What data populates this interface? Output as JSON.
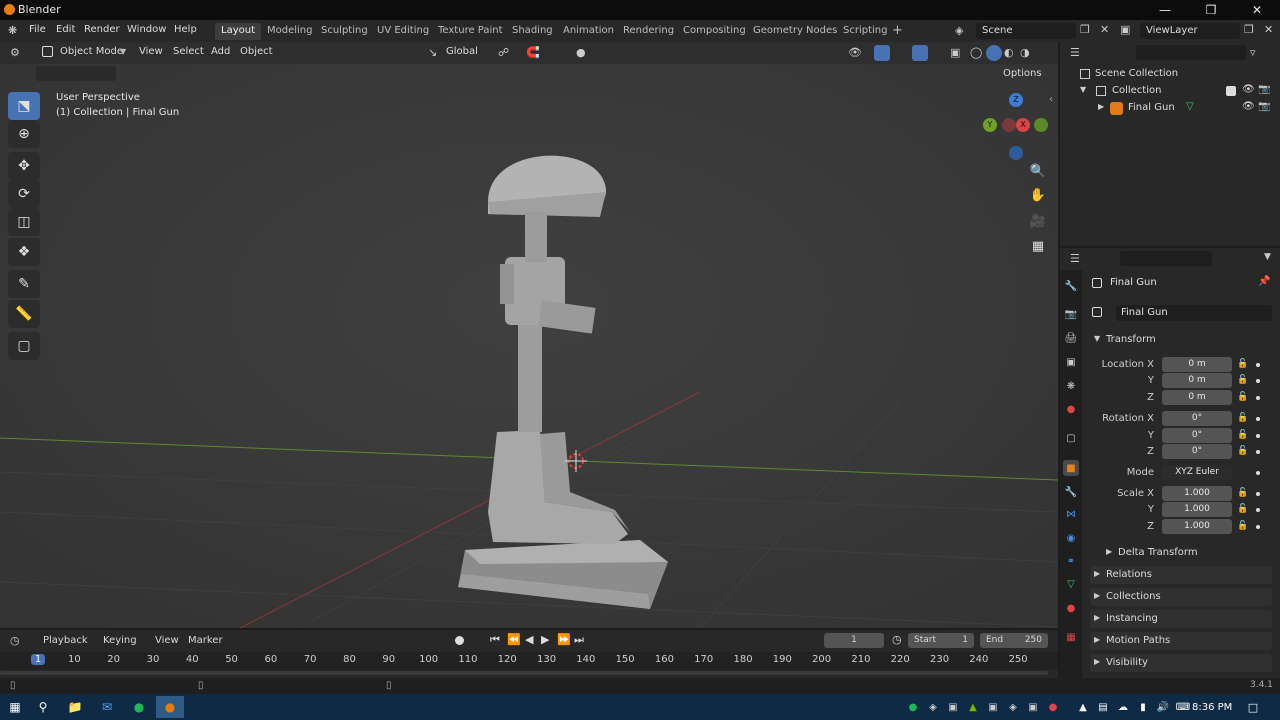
{
  "window": {
    "title": "Blender"
  },
  "menu": [
    "File",
    "Edit",
    "Render",
    "Window",
    "Help"
  ],
  "workspaces": [
    "Layout",
    "Modeling",
    "Sculpting",
    "UV Editing",
    "Texture Paint",
    "Shading",
    "Animation",
    "Rendering",
    "Compositing",
    "Geometry Nodes",
    "Scripting"
  ],
  "active_workspace": "Layout",
  "scene": {
    "scene_name": "Scene",
    "view_layer": "ViewLayer"
  },
  "viewport": {
    "mode": "Object Mode",
    "menus": [
      "View",
      "Select",
      "Add",
      "Object"
    ],
    "transform_orientation": "Global",
    "options_label": "Options",
    "overlay_title": "User Perspective",
    "overlay_subtitle": "(1) Collection | Final Gun",
    "gizmo_labels": {
      "z": "Z",
      "y": "Y",
      "x": "X"
    }
  },
  "outliner": {
    "items": [
      {
        "label": "Scene Collection",
        "icon": "collection-icon"
      },
      {
        "label": "Collection",
        "icon": "collection-icon"
      },
      {
        "label": "Final Gun",
        "icon": "mesh-object-icon"
      }
    ]
  },
  "properties": {
    "object_name": "Final Gun",
    "data_name": "Final Gun",
    "transform_header": "Transform",
    "location_label": "Location X",
    "rotation_label": "Rotation X",
    "scale_label": "Scale X",
    "axis_labels": [
      "Y",
      "Z"
    ],
    "location": [
      "0 m",
      "0 m",
      "0 m"
    ],
    "rotation": [
      "0°",
      "0°",
      "0°"
    ],
    "mode_label": "Mode",
    "mode_value": "XYZ Euler",
    "scale": [
      "1.000",
      "1.000",
      "1.000"
    ],
    "delta_transform": "Delta Transform",
    "panels": [
      "Relations",
      "Collections",
      "Instancing",
      "Motion Paths",
      "Visibility"
    ]
  },
  "timeline": {
    "menus": [
      "Playback",
      "Keying",
      "View",
      "Marker"
    ],
    "current_frame": "1",
    "start_label": "Start",
    "start_value": "1",
    "end_label": "End",
    "end_value": "250",
    "ticks": [
      "1",
      "10",
      "20",
      "30",
      "40",
      "50",
      "60",
      "70",
      "80",
      "90",
      "100",
      "110",
      "120",
      "130",
      "140",
      "150",
      "160",
      "170",
      "180",
      "190",
      "200",
      "210",
      "220",
      "230",
      "240",
      "250"
    ]
  },
  "status": {
    "version": "3.4.1"
  },
  "taskbar": {
    "time": "8:36 PM"
  }
}
